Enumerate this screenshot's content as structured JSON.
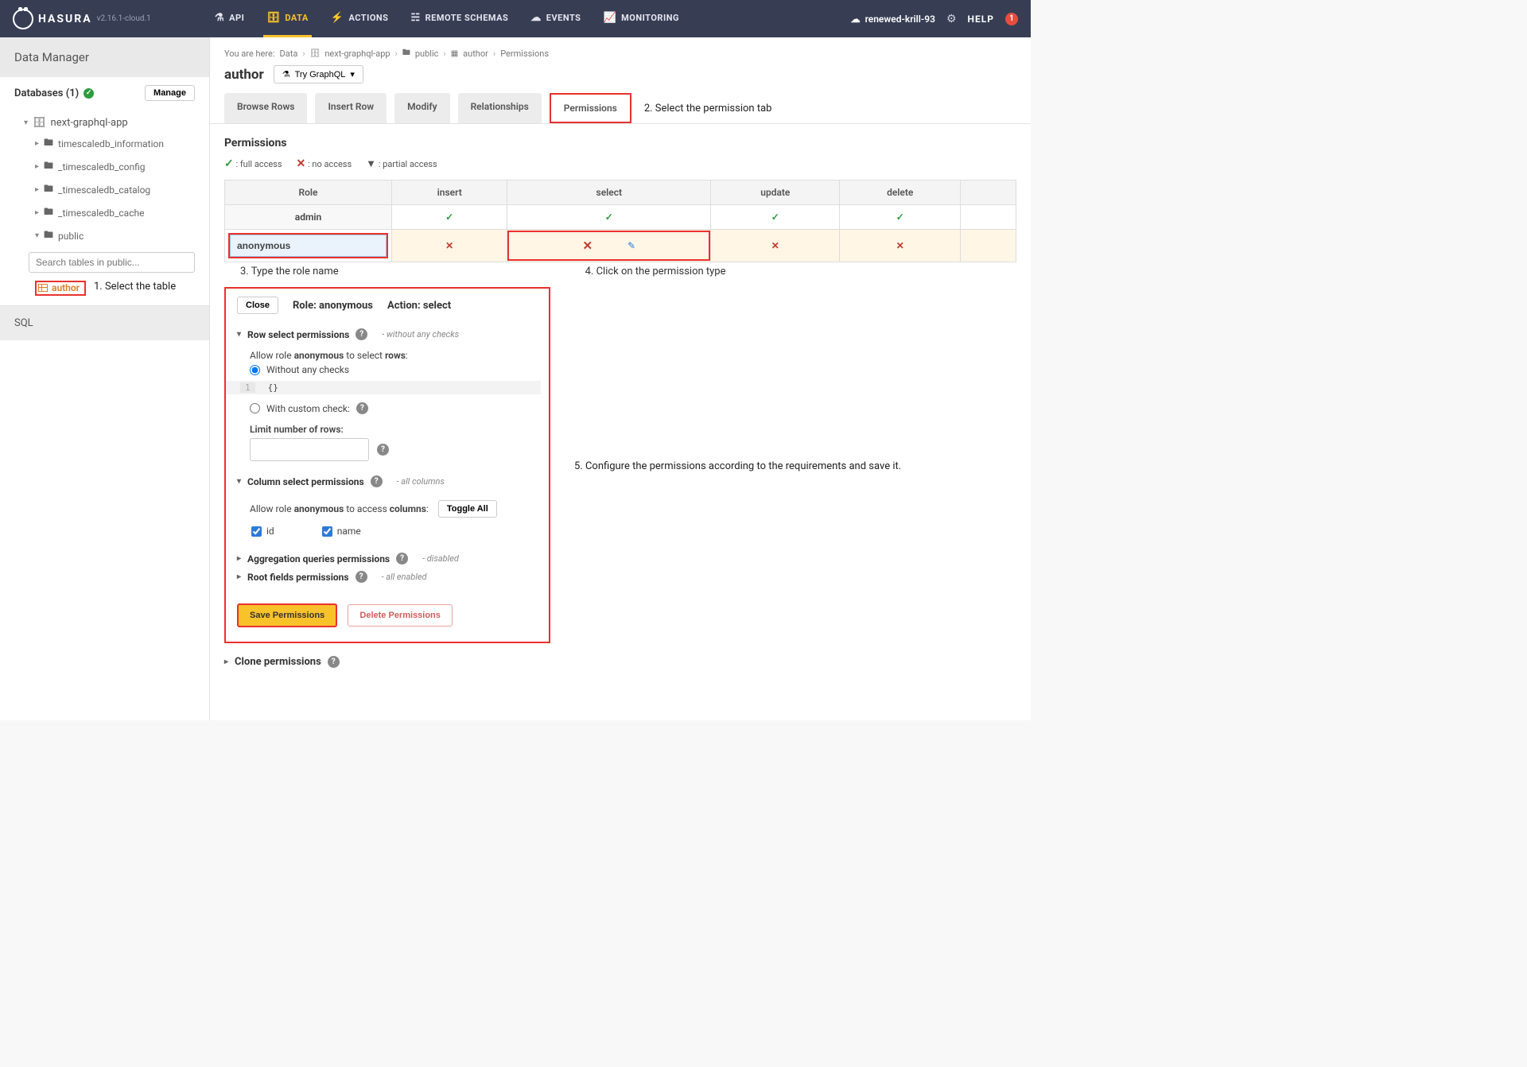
{
  "header": {
    "brand": "HASURA",
    "version": "v2.16.1-cloud.1",
    "nav": [
      {
        "label": "API",
        "icon": "⚗"
      },
      {
        "label": "DATA",
        "icon": "🗄",
        "active": true
      },
      {
        "label": "ACTIONS",
        "icon": "⚡"
      },
      {
        "label": "REMOTE SCHEMAS",
        "icon": "☵"
      },
      {
        "label": "EVENTS",
        "icon": "☁"
      },
      {
        "label": "MONITORING",
        "icon": "📈"
      }
    ],
    "project": "renewed-krill-93",
    "help": "HELP",
    "notif_count": "1"
  },
  "sidebar": {
    "title": "Data Manager",
    "databases_label": "Databases (1)",
    "manage": "Manage",
    "db_name": "next-graphql-app",
    "schemas": [
      "timescaledb_information",
      "_timescaledb_config",
      "_timescaledb_catalog",
      "_timescaledb_cache",
      "public"
    ],
    "search_placeholder": "Search tables in public...",
    "table": "author",
    "sql": "SQL"
  },
  "breadcrumb": {
    "prefix": "You are here:",
    "parts": [
      "Data",
      "next-graphql-app",
      "public",
      "author",
      "Permissions"
    ]
  },
  "page": {
    "title": "author",
    "try_graphql": "Try GraphQL"
  },
  "tabs": [
    "Browse Rows",
    "Insert Row",
    "Modify",
    "Relationships",
    "Permissions"
  ],
  "perm": {
    "title": "Permissions",
    "legend_full": ": full access",
    "legend_no": ": no access",
    "legend_partial": ": partial access",
    "cols": [
      "Role",
      "insert",
      "select",
      "update",
      "delete"
    ],
    "admin": "admin",
    "anon_value": "anonymous"
  },
  "editor": {
    "close": "Close",
    "role_label": "Role: anonymous",
    "action_label": "Action: select",
    "row_section": "Row select permissions",
    "row_hint": "- without any checks",
    "row_desc_pre": "Allow role ",
    "row_desc_role": "anonymous",
    "row_desc_mid": " to select ",
    "row_desc_rows": "rows",
    "opt_no_checks": "Without any checks",
    "without_check_code": "{}",
    "opt_custom": "With custom check:",
    "limit_label": "Limit number of rows:",
    "col_section": "Column select permissions",
    "col_hint": "- all columns",
    "col_desc_pre": "Allow role ",
    "col_desc_role": "anonymous",
    "col_desc_mid": " to access ",
    "col_desc_cols": "columns",
    "toggle_all": "Toggle All",
    "col_id": "id",
    "col_name": "name",
    "agg_section": "Aggregation queries permissions",
    "agg_hint": "- disabled",
    "root_section": "Root fields permissions",
    "root_hint": "- all enabled",
    "save": "Save Permissions",
    "delete": "Delete Permissions"
  },
  "clone": {
    "label": "Clone permissions"
  },
  "annotations": {
    "a1": "1. Select the table",
    "a2": "2. Select the permission tab",
    "a3": "3. Type the role name",
    "a4": "4. Click on the permission type",
    "a5": "5. Configure the permissions according to the requirements and save it."
  }
}
